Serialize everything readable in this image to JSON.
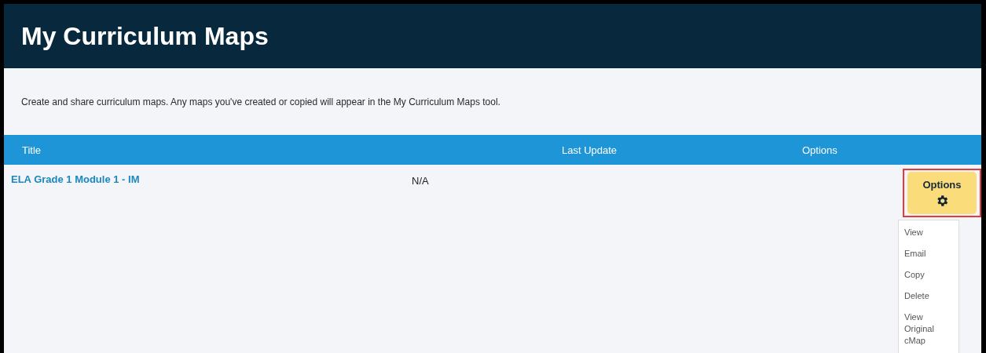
{
  "header": {
    "title": "My Curriculum Maps"
  },
  "description": "Create and share curriculum maps. Any maps you've created or copied will appear in the My Curriculum Maps tool.",
  "table": {
    "columns": [
      "Title",
      "Last Update",
      "Options"
    ],
    "rows": [
      {
        "title": "ELA Grade 1 Module 1 - IM",
        "last_update": "N/A",
        "options_button": {
          "label": "Options",
          "highlighted": true,
          "expanded": true
        },
        "menu": [
          "View",
          "Email",
          "Copy",
          "Delete",
          "View Original cMap"
        ]
      }
    ]
  }
}
